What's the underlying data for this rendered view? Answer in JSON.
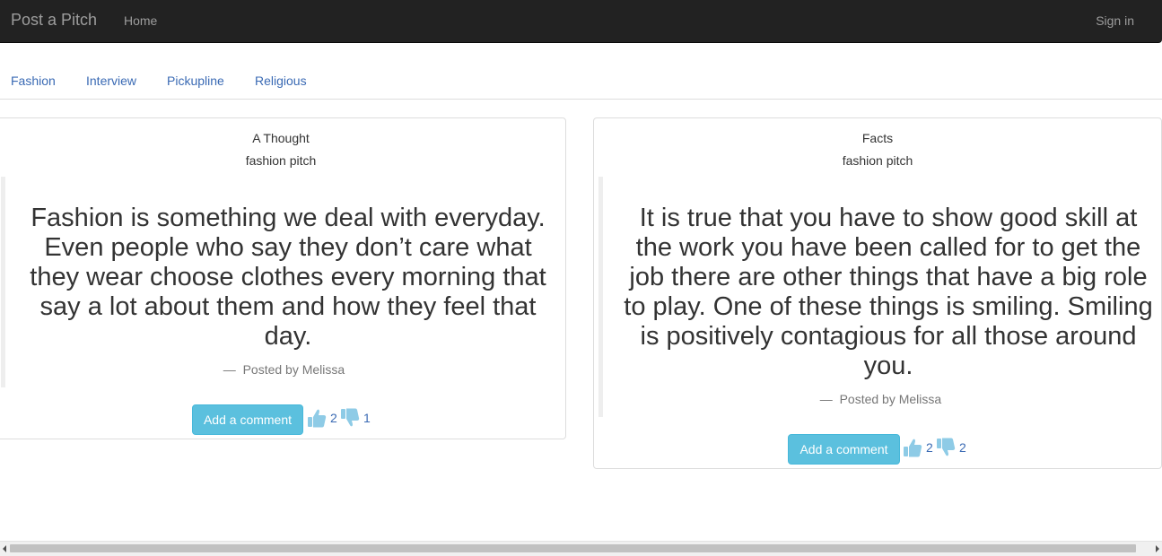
{
  "navbar": {
    "brand": "Post a Pitch",
    "home": "Home",
    "signin": "Sign in"
  },
  "categories": [
    "Fashion",
    "Interview",
    "Pickupline",
    "Religious"
  ],
  "pitches": [
    {
      "title": "A Thought",
      "category": "fashion pitch",
      "body": "Fashion is something we deal with everyday. Even people who say they don’t care what they wear choose clothes every morning that say a lot about them and how they feel that day.",
      "dash": "—",
      "footer": "Posted by Melissa",
      "comment_label": "Add a comment",
      "upvotes": "2",
      "downvotes": "1"
    },
    {
      "title": "Facts",
      "category": "fashion pitch",
      "body": "It is true that you have to show good skill at the work you have been called for to get the job there are other things that have a big role to play. One of these things is smiling. Smiling is positively contagious for all those around you.",
      "dash": "—",
      "footer": "Posted by Melissa",
      "comment_label": "Add a comment",
      "upvotes": "2",
      "downvotes": "2"
    }
  ],
  "colors": {
    "navbar_bg": "#222222",
    "link": "#3a6ab4",
    "button": "#5bc0de",
    "vote_icon": "#8ecbe6"
  },
  "icons": {
    "upvote": "thumbs-up-icon",
    "downvote": "thumbs-down-icon"
  }
}
